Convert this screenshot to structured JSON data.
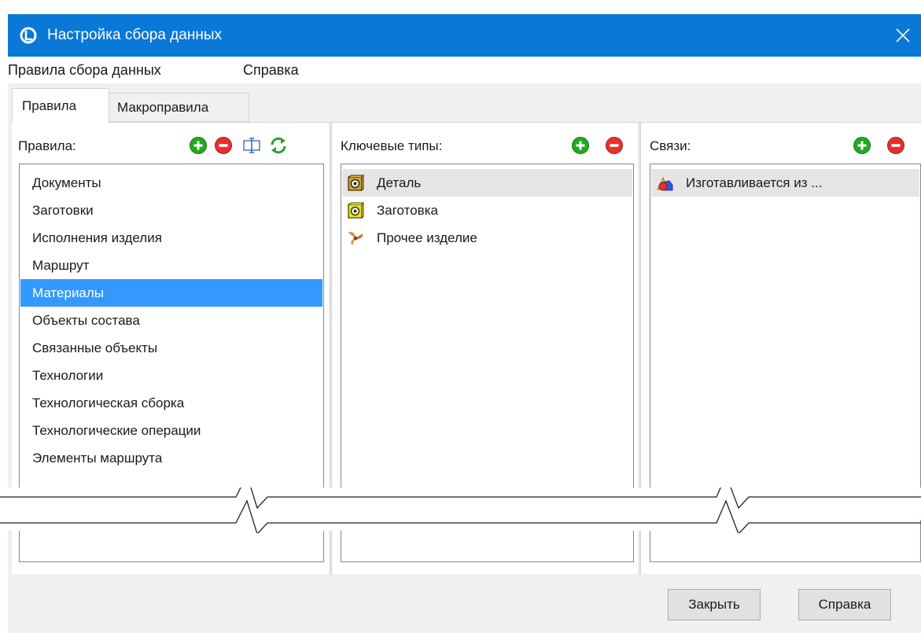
{
  "window": {
    "title": "Настройка сбора данных",
    "app_icon": "app-logo-icon",
    "close_icon": "close-icon"
  },
  "menu": {
    "items": [
      "Правила сбора данных",
      "Справка"
    ]
  },
  "tabs": [
    {
      "label": "Правила",
      "active": true
    },
    {
      "label": "Макроправила",
      "active": false
    }
  ],
  "rules_panel": {
    "label": "Правила:",
    "toolbar_icons": [
      "add-icon",
      "remove-icon",
      "rename-icon",
      "refresh-icon"
    ],
    "items": [
      "Документы",
      "Заготовки",
      "Исполнения изделия",
      "Маршрут",
      "Материалы",
      "Объекты состава",
      "Связанные объекты",
      "Технологии",
      "Технологическая сборка",
      "Технологические операции",
      "Элементы маршрута"
    ],
    "selected": "Материалы"
  },
  "key_types_panel": {
    "label": "Ключевые типы:",
    "toolbar_icons": [
      "add-icon",
      "remove-icon"
    ],
    "items": [
      {
        "label": "Деталь",
        "icon": "part-icon"
      },
      {
        "label": "Заготовка",
        "icon": "blank-icon"
      },
      {
        "label": "Прочее изделие",
        "icon": "other-product-icon"
      }
    ],
    "highlighted": "Деталь"
  },
  "links_panel": {
    "label": "Связи:",
    "toolbar_icons": [
      "add-icon",
      "remove-icon"
    ],
    "items": [
      {
        "label": "Изготавливается из ...",
        "icon": "shapes-icon"
      }
    ]
  },
  "footer": {
    "close_label": "Закрыть",
    "help_label": "Справка"
  },
  "colors": {
    "titlebar": "#0a78d7",
    "selection": "#3399ff",
    "add": "#22a822",
    "remove": "#e53030"
  }
}
